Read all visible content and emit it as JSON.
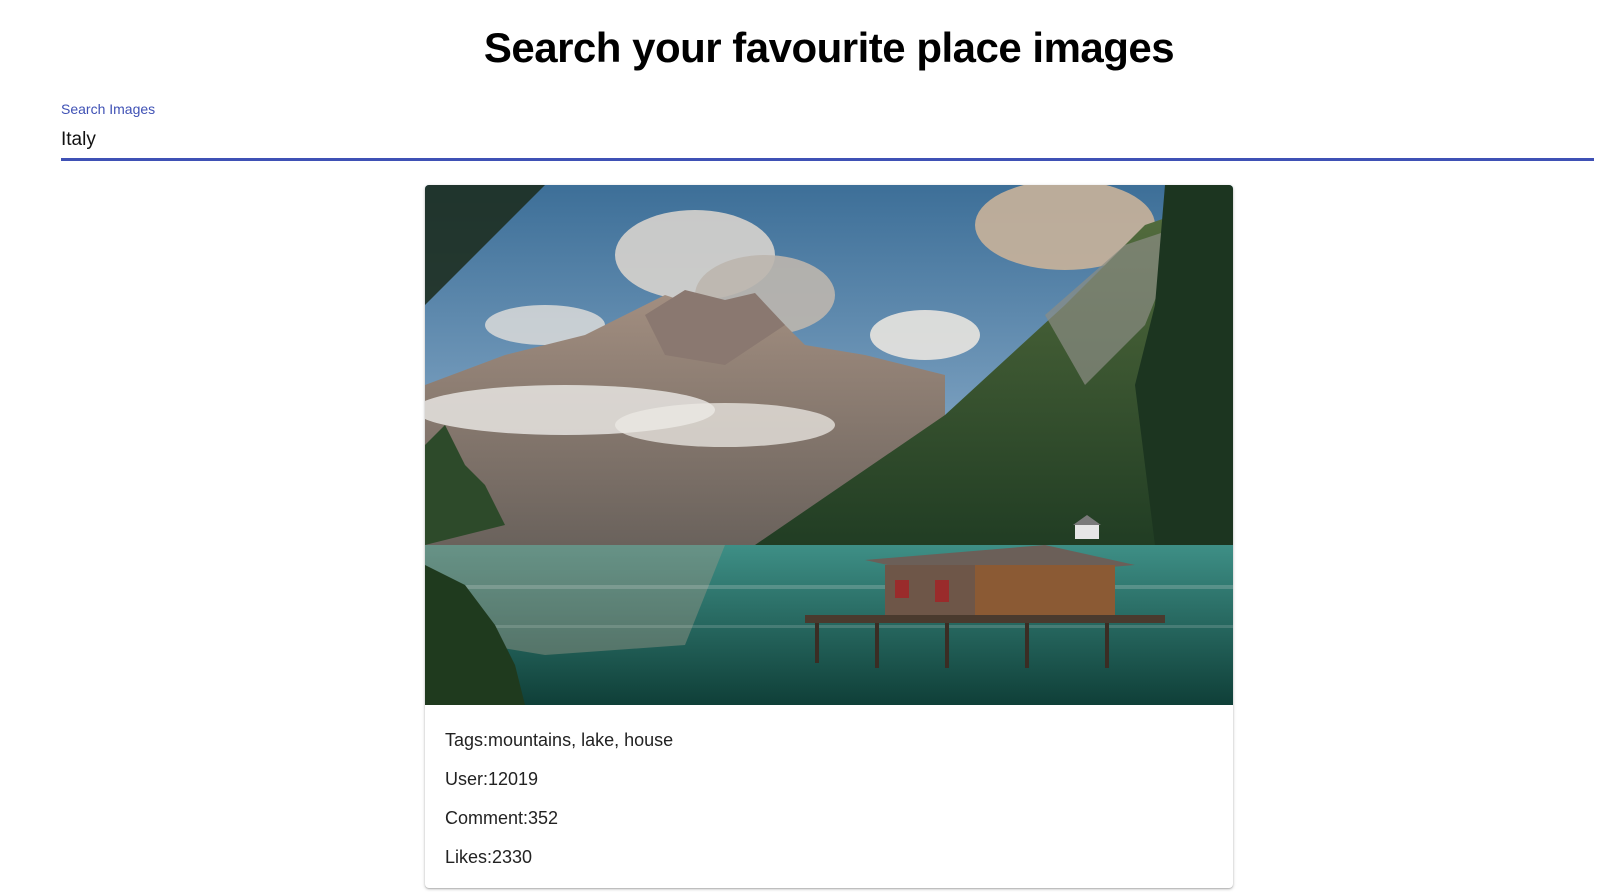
{
  "header": {
    "title": "Search your favourite place images"
  },
  "search": {
    "label": "Search Images",
    "value": "Italy",
    "accent_color": "#3f51b5"
  },
  "result_card": {
    "image_icon": "landscape-photo",
    "image_subject": "mountains, lake, house",
    "tags_label": "Tags:mountains, lake, house",
    "user_label": "User:12019",
    "comment_label": "Comment:352",
    "likes_label": "Likes:2330"
  }
}
